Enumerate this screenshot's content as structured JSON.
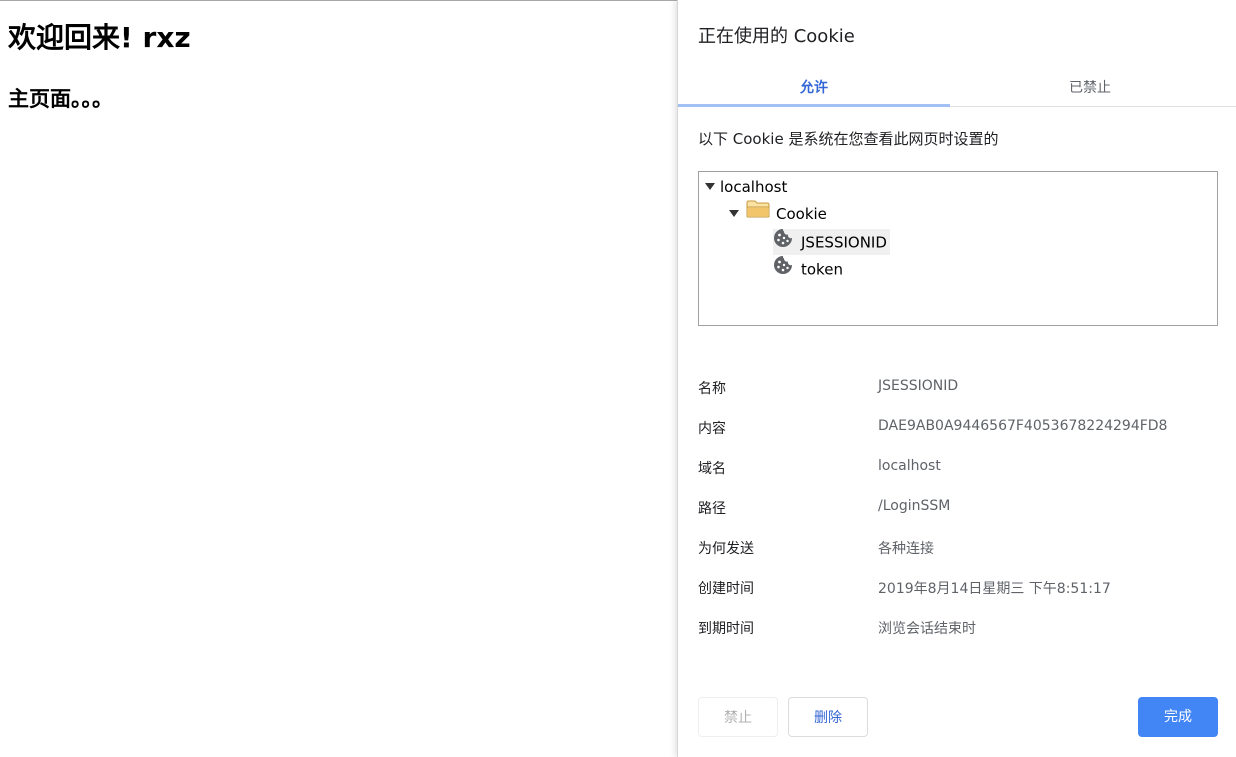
{
  "page": {
    "heading": "欢迎回来! rxz",
    "subheading": "主页面。。。"
  },
  "dialog": {
    "title": "正在使用的 Cookie",
    "tabs": [
      {
        "label": "允许",
        "active": true
      },
      {
        "label": "已禁止",
        "active": false
      }
    ],
    "description": "以下 Cookie 是系统在您查看此网页时设置的",
    "tree": {
      "host": "localhost",
      "folder": "Cookie",
      "cookies": [
        "JSESSIONID",
        "token"
      ],
      "selected": "JSESSIONID"
    },
    "details": [
      {
        "label": "名称",
        "value": "JSESSIONID"
      },
      {
        "label": "内容",
        "value": "DAE9AB0A9446567F4053678224294FD8"
      },
      {
        "label": "域名",
        "value": "localhost"
      },
      {
        "label": "路径",
        "value": "/LoginSSM"
      },
      {
        "label": "为何发送",
        "value": "各种连接"
      },
      {
        "label": "创建时间",
        "value": "2019年8月14日星期三 下午8:51:17"
      },
      {
        "label": "到期时间",
        "value": "浏览会话结束时"
      }
    ],
    "buttons": {
      "block": "禁止",
      "delete": "删除",
      "done": "完成"
    },
    "colors": {
      "accent": "#4285f4",
      "tab_active_text": "#3367d6",
      "tab_underline": "#a3c0f4",
      "folder": "#f3c56a"
    },
    "icons": {
      "expand": "triangle-down-icon",
      "folder": "folder-icon",
      "cookie": "cookie-icon"
    }
  }
}
